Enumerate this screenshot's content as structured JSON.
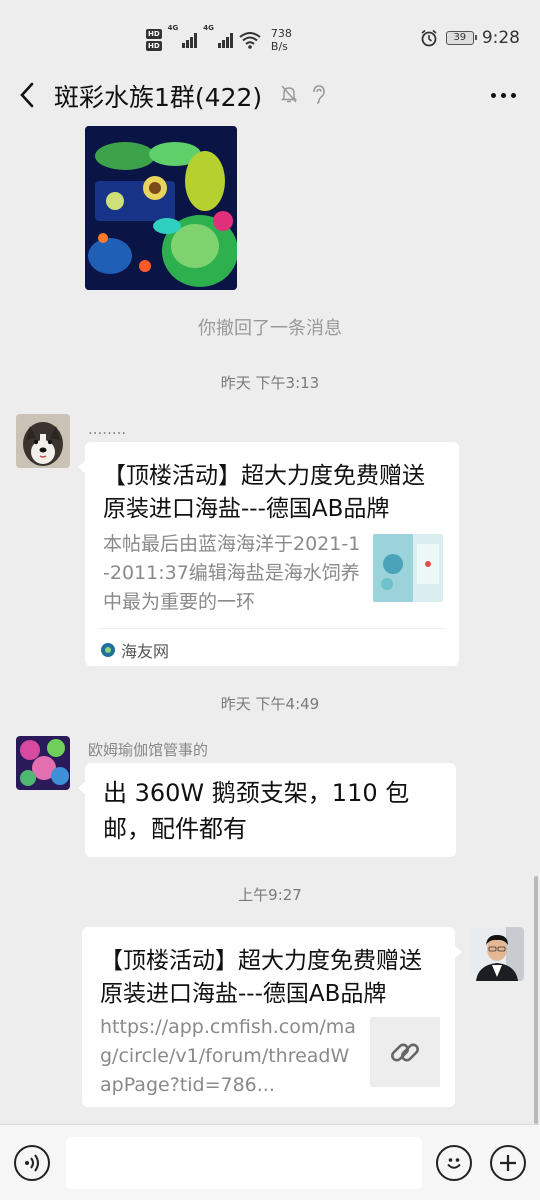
{
  "status_bar": {
    "hd1": "HD",
    "hd2": "HD",
    "net1": "4G",
    "net2": "4G",
    "speed_value": "738",
    "speed_unit": "B/s",
    "battery": "39",
    "time": "9:28"
  },
  "header": {
    "title": "斑彩水族1群(422)"
  },
  "messages": {
    "recalled": "你撤回了一条消息",
    "time1": "昨天 下午3:13",
    "msg1": {
      "sender": "........",
      "title": "【顶楼活动】超大力度免费赠送原装进口海盐---德国AB品牌",
      "desc": "本帖最后由蓝海海洋于2021-1-2011:37编辑海盐是海水饲养中最为重要的一环",
      "source": "海友网"
    },
    "time2": "昨天 下午4:49",
    "msg2": {
      "sender": "欧姆瑜伽馆管事的",
      "text": "出 360W 鹅颈支架，110 包邮，配件都有"
    },
    "time3": "上午9:27",
    "msg3": {
      "title": "【顶楼活动】超大力度免费赠送原装进口海盐---德国AB品牌",
      "desc": "https://app.cmfish.com/mag/circle/v1/forum/threadWapPage?tid=786..."
    }
  },
  "colors": {
    "background": "#ededed",
    "bubble": "#ffffff",
    "system_text": "#999999"
  }
}
